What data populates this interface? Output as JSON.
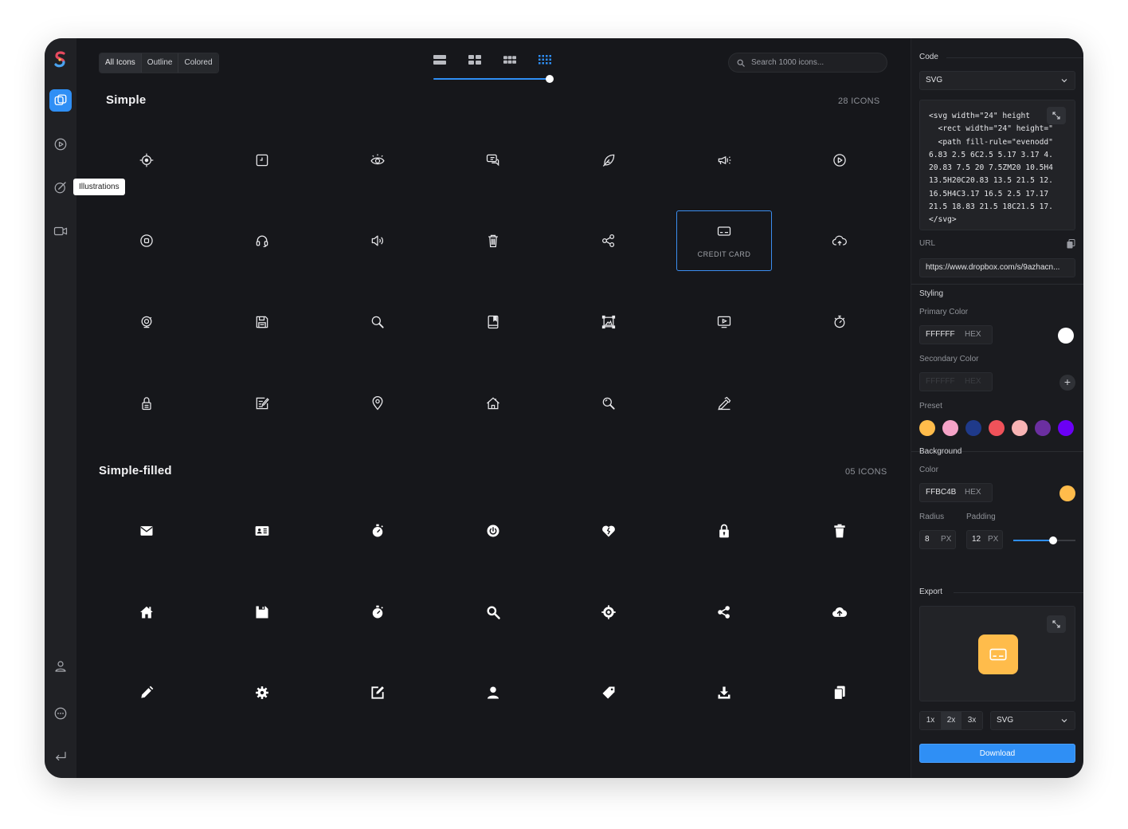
{
  "sidebar": {
    "tooltip": "Illustrations"
  },
  "toolbar": {
    "filters": [
      "All Icons",
      "Outline",
      "Colored"
    ],
    "search_placeholder": "Search 1000 icons..."
  },
  "sections": {
    "simple": {
      "title": "Simple",
      "count": "28 ICONS"
    },
    "filled": {
      "title": "Simple-filled",
      "count": "05 ICONS"
    }
  },
  "selected_icon_label": "CREDIT CARD",
  "panel": {
    "code_label": "Code",
    "format": "SVG",
    "code_lines": [
      "<svg width=\"24\" height",
      "  <rect width=\"24\" height=\"",
      "  <path fill-rule=\"evenodd\"",
      "6.83 2.5 6C2.5 5.17 3.17 4.",
      "20.83 7.5 20 7.5ZM20 10.5H4",
      "13.5H20C20.83 13.5 21.5 12.",
      "16.5H4C3.17 16.5 2.5 17.17",
      "21.5 18.83 21.5 18C21.5 17.",
      "</svg>"
    ],
    "url_label": "URL",
    "url_value": "https://www.dropbox.com/s/9azhacn...",
    "styling_label": "Styling",
    "primary_label": "Primary Color",
    "primary_hex": "FFFFFF",
    "secondary_label": "Secondary Color",
    "secondary_hex": "FFFFFF",
    "hex_unit": "HEX",
    "preset_label": "Preset",
    "presets": [
      "#ffbc4b",
      "#f5a3c7",
      "#1f3a8a",
      "#f0525a",
      "#f8b4b4",
      "#6b2fa0",
      "#6b00f5"
    ],
    "background_label": "Background",
    "color_label": "Color",
    "bg_hex": "FFBC4B",
    "bg_color": "#ffbc4b",
    "radius_label": "Radius",
    "padding_label": "Padding",
    "radius_value": "8",
    "padding_value": "12",
    "px_unit": "PX",
    "export_label": "Export",
    "scales": [
      "1x",
      "2x",
      "3x"
    ],
    "export_format": "SVG",
    "download_label": "Download"
  },
  "icons_simple": [
    "crosshair-icon",
    "clock-square-icon",
    "eye-icon",
    "chat-icon",
    "feather-icon",
    "megaphone-icon",
    "play-circle-icon",
    "stop-circle-icon",
    "headphones-icon",
    "volume-icon",
    "trash-icon",
    "share-icon",
    "credit-card-icon",
    "cloud-upload-icon",
    "webcam-icon",
    "floppy-icon",
    "search-icon",
    "book-icon",
    "image-frame-icon",
    "video-screen-icon",
    "stopwatch-icon",
    "lock-icon",
    "edit-note-icon",
    "map-pin-icon",
    "home-icon",
    "zoom-icon",
    "pen-icon"
  ],
  "icons_filled": [
    "mail-icon",
    "id-card-icon",
    "stopwatch-icon",
    "power-icon",
    "heart-broken-icon",
    "lock-icon",
    "trash-icon",
    "home-icon",
    "floppy-icon",
    "stopwatch-icon",
    "search-icon",
    "target-icon",
    "share-icon",
    "cloud-upload-icon",
    "pencil-icon",
    "gear-icon",
    "edit-icon",
    "user-icon",
    "tag-icon",
    "download-icon",
    "copy-icon"
  ]
}
